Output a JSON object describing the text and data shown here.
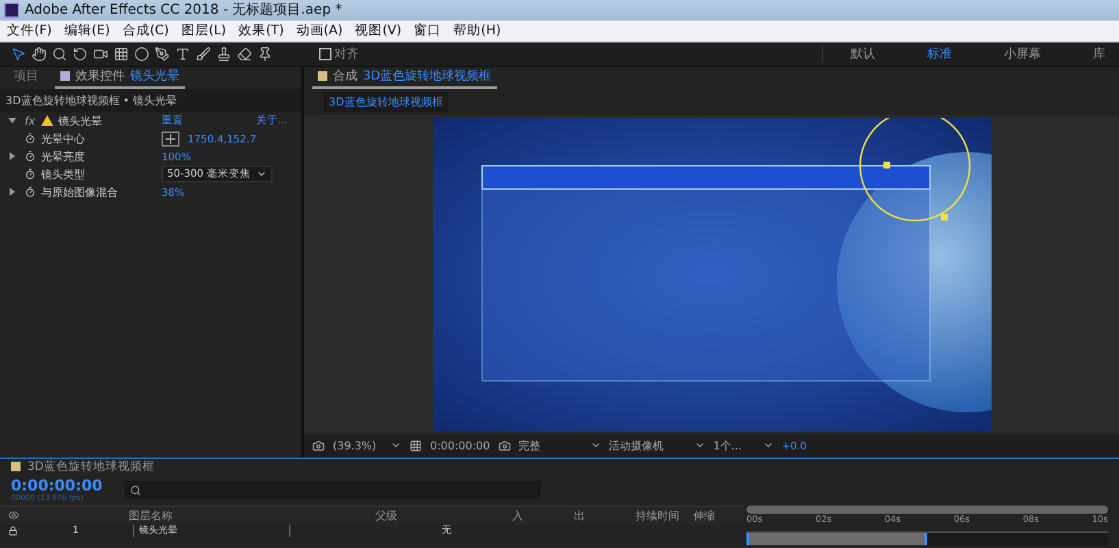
{
  "window": {
    "title": "Adobe After Effects CC 2018 - 无标题项目.aep *"
  },
  "menu": [
    "文件(F)",
    "编辑(E)",
    "合成(C)",
    "图层(L)",
    "效果(T)",
    "动画(A)",
    "视图(V)",
    "窗口",
    "帮助(H)"
  ],
  "toolbar": {
    "snap": {
      "label": "对齐",
      "checked": false
    },
    "workspaces": [
      {
        "label": "默认",
        "selected": false
      },
      {
        "label": "标准",
        "selected": true
      },
      {
        "label": "小屏幕",
        "selected": false
      },
      {
        "label": "库",
        "selected": false
      }
    ]
  },
  "effect_panel": {
    "tabs": [
      {
        "label": "项目",
        "selected": false
      },
      {
        "label": "效果控件",
        "layer": "镜头光晕",
        "selected": true
      }
    ],
    "breadcrumb": "3D蓝色旋转地球视频框 • 镜头光晕",
    "effect": {
      "badge": "fx",
      "name": "镜头光晕",
      "expanded": true,
      "reset": "重置",
      "about": "关于...",
      "properties": [
        {
          "kind": "point",
          "name": "光晕中心",
          "value": "1750.4,152.7"
        },
        {
          "kind": "number",
          "name": "光晕亮度",
          "value": "100%"
        },
        {
          "kind": "dropdown",
          "name": "镜头类型",
          "value": "50-300 毫米变焦"
        },
        {
          "kind": "number",
          "name": "与原始图像混合",
          "value": "38%"
        }
      ]
    }
  },
  "comp_panel": {
    "tab": {
      "label": "合成",
      "name": "3D蓝色旋转地球视频框"
    },
    "subtab": "3D蓝色旋转地球视频框",
    "viewer_bar": {
      "zoom": "(39.3%)",
      "time": "0:00:00:00",
      "resolution": "完整",
      "camera": "活动摄像机",
      "views": "1个...",
      "exposure": "+0.0"
    }
  },
  "timeline": {
    "tab": "3D蓝色旋转地球视频框",
    "time": "0:00:00:00",
    "fps": "00000 (23.976 fps)",
    "columns": [
      "图层名称",
      "父级",
      "入",
      "出",
      "持续时间",
      "伸缩"
    ],
    "ruler": [
      "00s",
      "02s",
      "04s",
      "06s",
      "08s",
      "10s"
    ],
    "work_area": {
      "level": 0.5
    },
    "layers": [
      {
        "number": "1",
        "name": "镜头光晕",
        "parent": "无"
      }
    ]
  }
}
